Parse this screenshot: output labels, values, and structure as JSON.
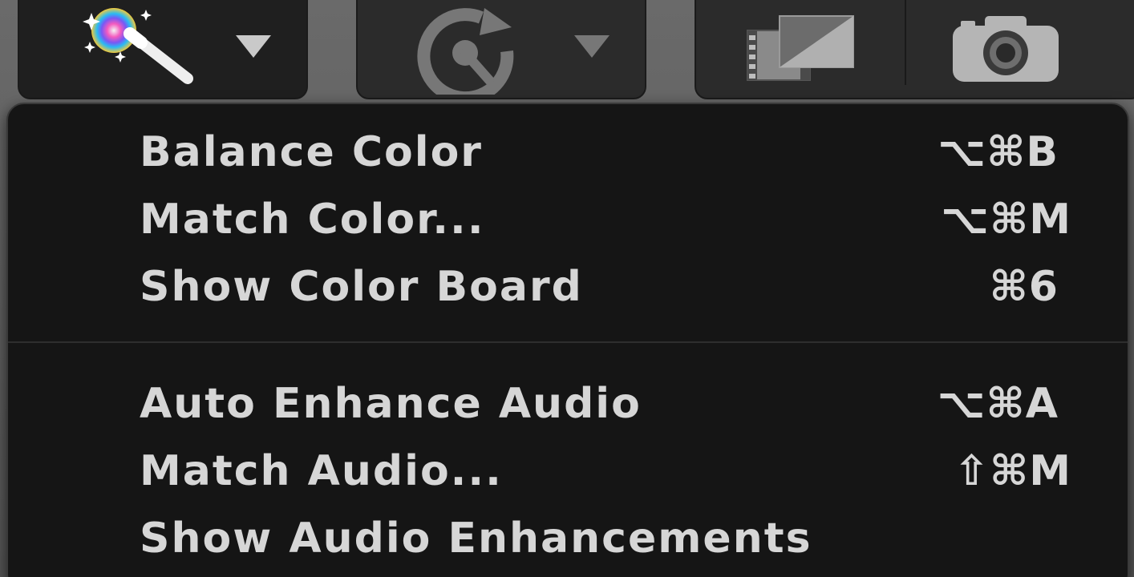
{
  "toolbar": {
    "enhance_icon": "magic-wand-icon",
    "retime_icon": "speedometer-retime-icon",
    "dropdown_icon": "triangle-down-icon",
    "transitions_icon": "filmstrip-transitions-icon",
    "snapshot_icon": "camera-icon"
  },
  "menu": {
    "items": [
      {
        "label": "Balance Color",
        "shortcut": "⌥⌘B"
      },
      {
        "label": "Match Color...",
        "shortcut": "⌥⌘M"
      },
      {
        "label": "Show Color Board",
        "shortcut": "⌘6"
      },
      {
        "label": "Auto Enhance Audio",
        "shortcut": "⌥⌘A"
      },
      {
        "label": "Match Audio...",
        "shortcut": "⇧⌘M"
      },
      {
        "label": "Show Audio Enhancements",
        "shortcut": ""
      }
    ]
  },
  "colors": {
    "menu_background": "#151515",
    "menu_text": "#d6d6d6",
    "toolbar_background": "#5c5c5c"
  }
}
